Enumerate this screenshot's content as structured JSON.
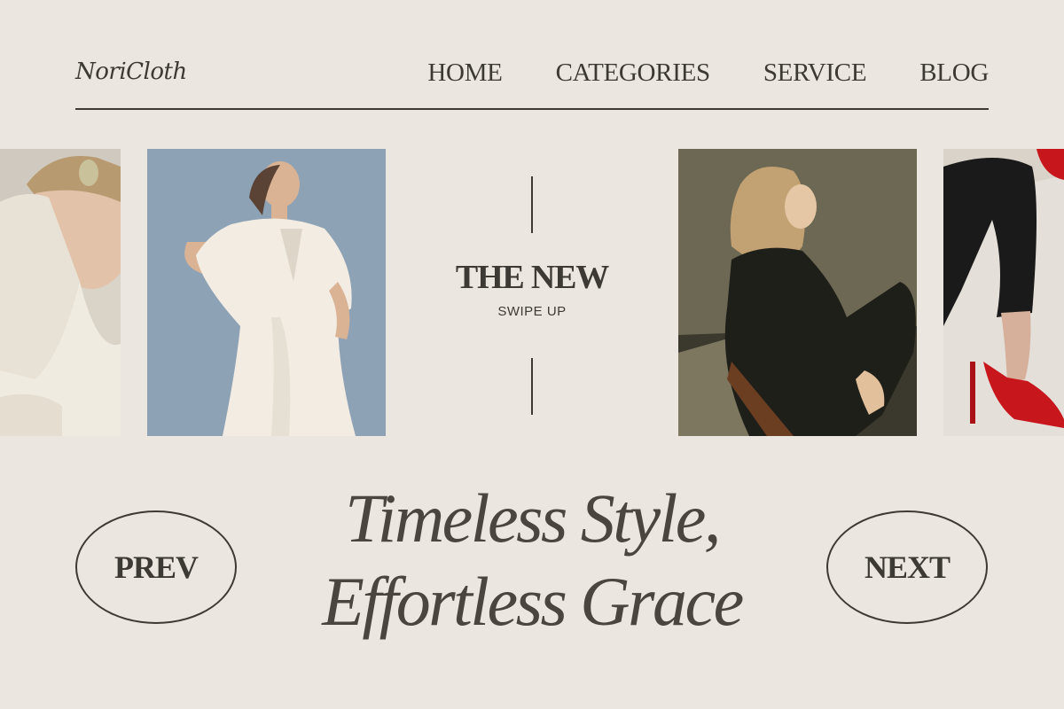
{
  "brand": {
    "name": "NoriCloth"
  },
  "nav": {
    "items": [
      {
        "label": "HOME"
      },
      {
        "label": "CATEGORIES"
      },
      {
        "label": "SERVICE"
      },
      {
        "label": "BLOG"
      }
    ]
  },
  "carousel": {
    "headline": "THE NEW",
    "subline": "SWIPE UP",
    "prev_label": "PREV",
    "next_label": "NEXT"
  },
  "hero": {
    "line1": "Timeless Style,",
    "line2": "Effortless Grace"
  },
  "colors": {
    "background": "#ebe6e0",
    "text": "#3d3934",
    "accent_red": "#c8161d",
    "sky_blue": "#8ea2b6"
  },
  "icons": {
    "photo_1": "woman-in-cream-wrap-top-photo",
    "photo_2": "woman-in-white-dress-photo",
    "photo_3": "woman-in-black-suit-photo",
    "photo_4": "red-heels-photo"
  }
}
